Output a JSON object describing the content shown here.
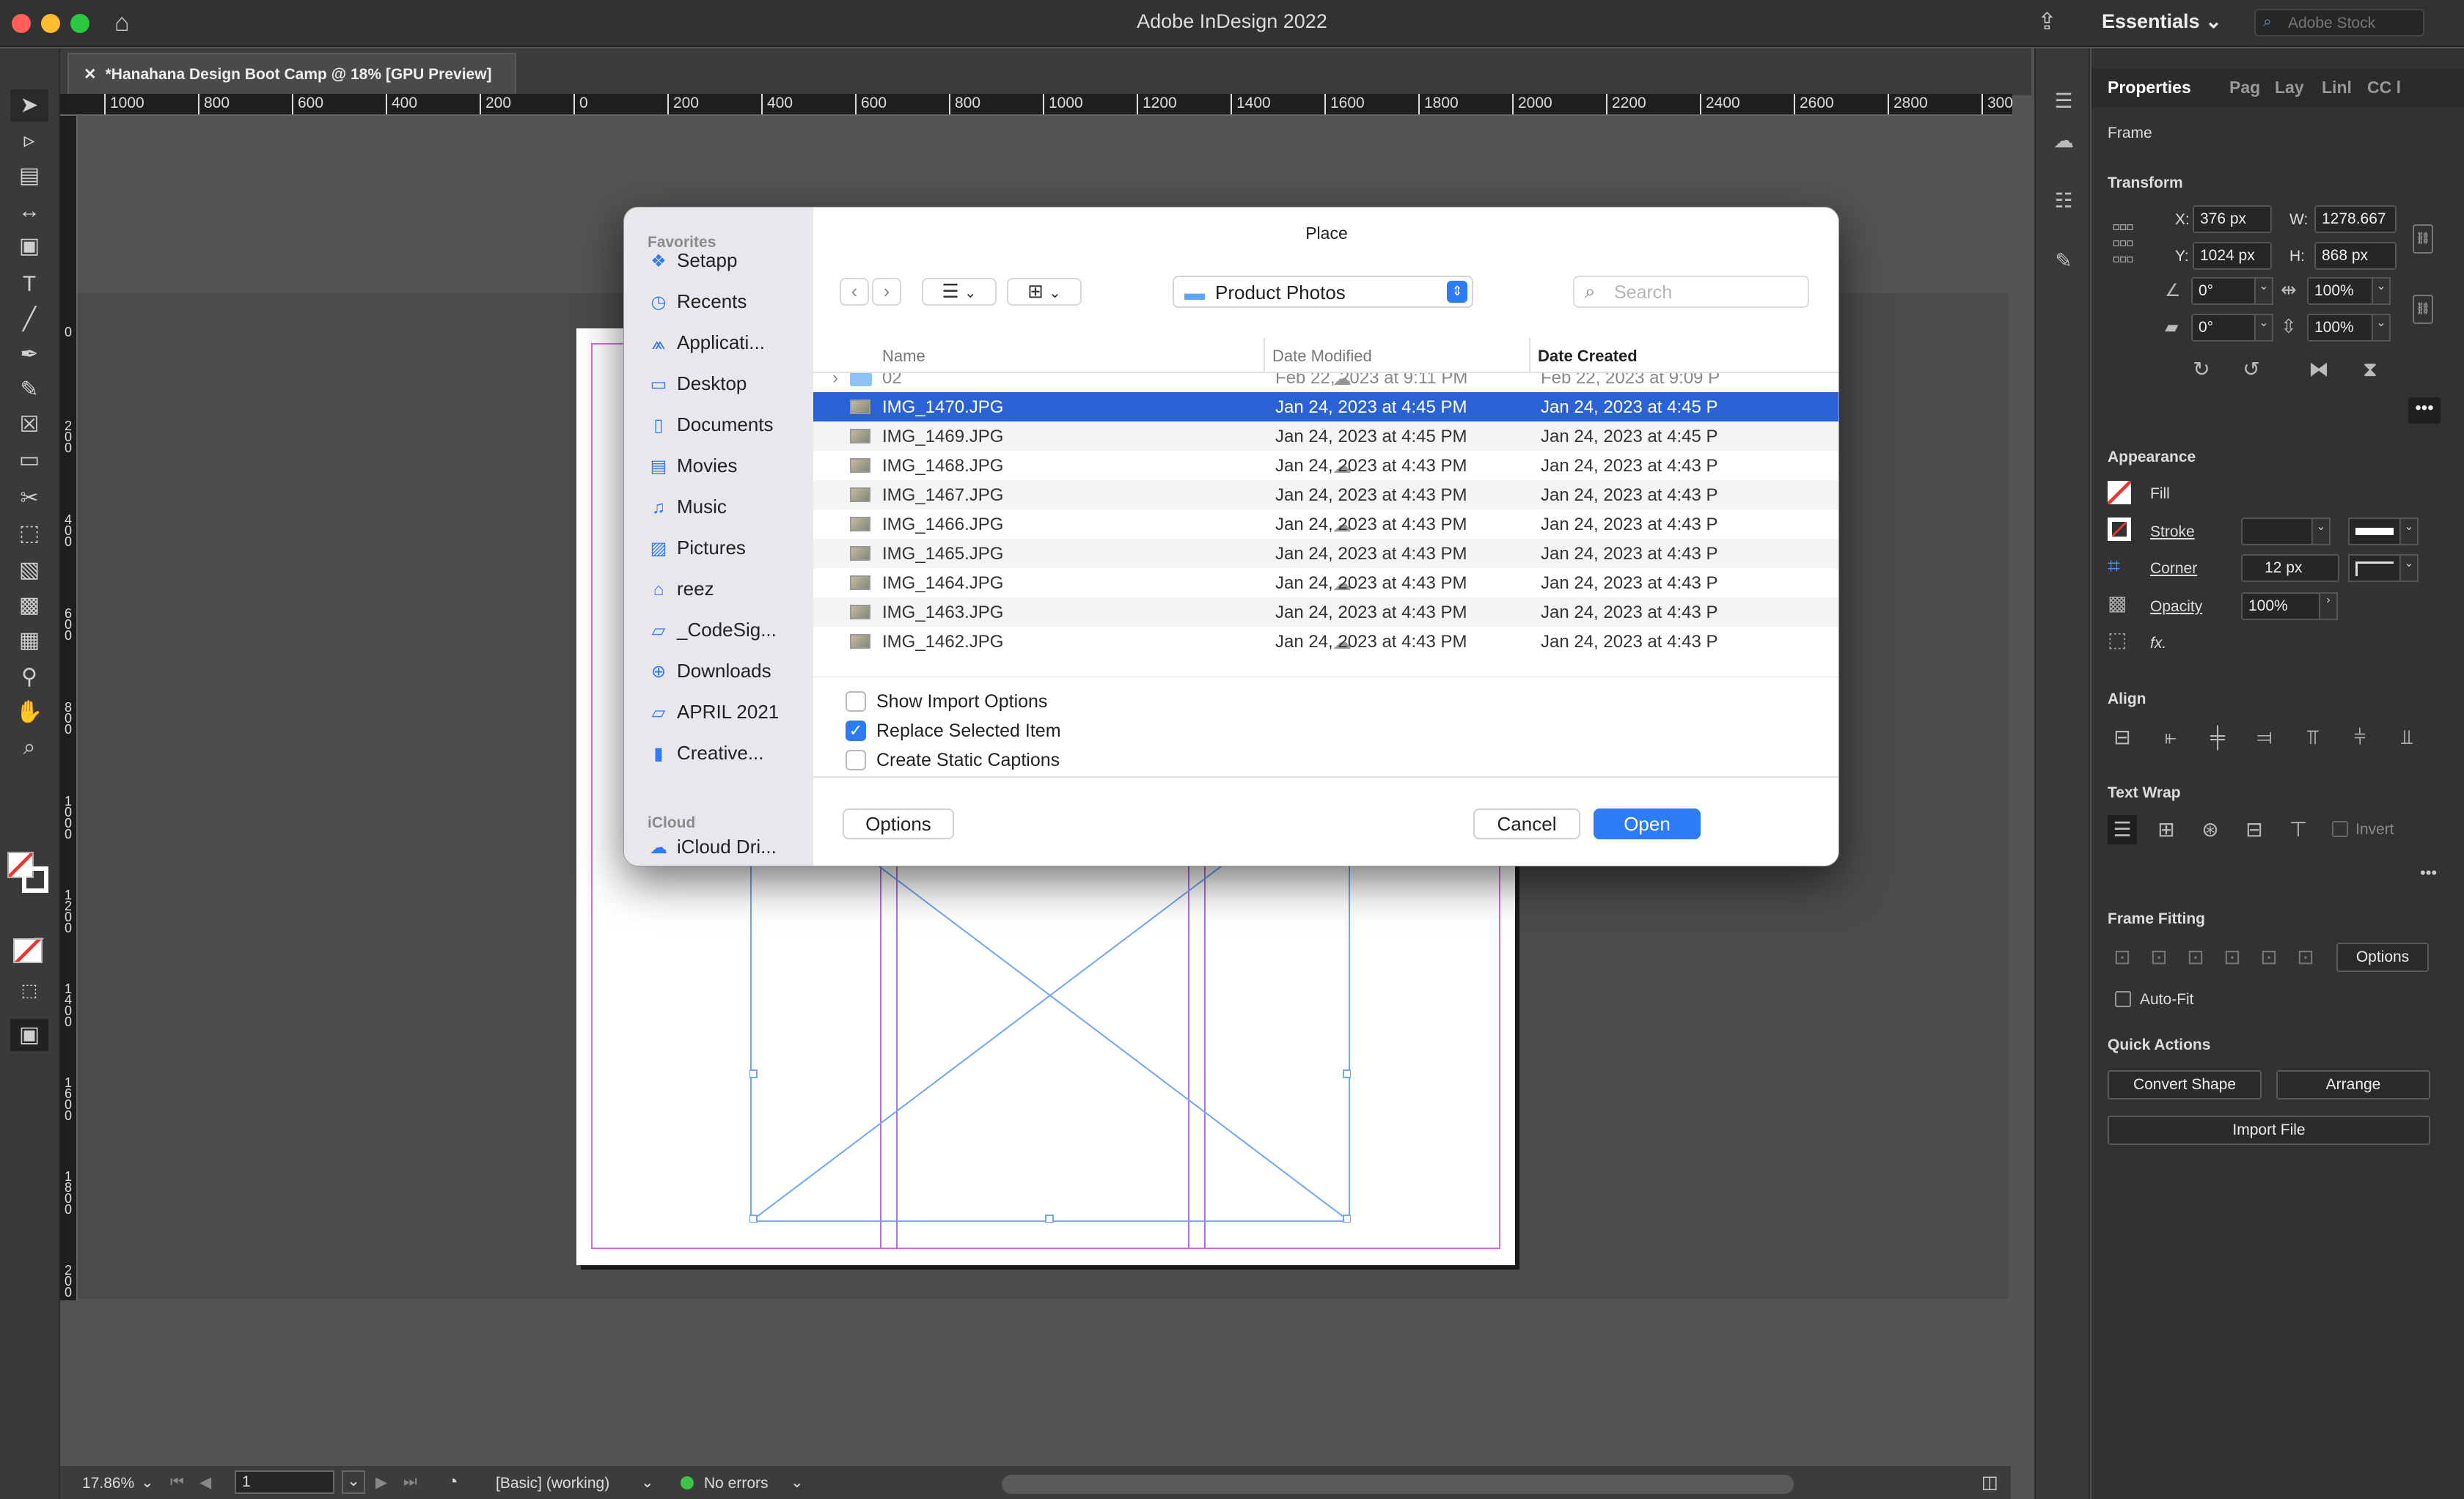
{
  "window": {
    "title": "Adobe InDesign 2022",
    "workspace": "Essentials",
    "stock_placeholder": "Adobe Stock"
  },
  "document": {
    "tab_title": "*Hanahana Design Boot Camp @ 18% [GPU Preview]"
  },
  "ruler": {
    "h_labels": [
      "1000",
      "800",
      "600",
      "400",
      "200",
      "0",
      "200",
      "400",
      "600",
      "800",
      "1000",
      "1200",
      "1400",
      "1600",
      "1800",
      "2000",
      "2200",
      "2400",
      "2600",
      "2800",
      "300"
    ],
    "v_labels": [
      "0",
      "200",
      "400",
      "600",
      "800",
      "1000",
      "1200",
      "1400",
      "1600",
      "1800",
      "200"
    ]
  },
  "status": {
    "zoom": "17.86%",
    "page": "1",
    "style": "[Basic] (working)",
    "errors": "No errors"
  },
  "panel": {
    "tabs": [
      "Properties",
      "Pag",
      "Lay",
      "Linl",
      "CC l"
    ],
    "frame_label": "Frame",
    "transform": {
      "heading": "Transform",
      "x_label": "X:",
      "x": "376 px",
      "y_label": "Y:",
      "y": "1024 px",
      "w_label": "W:",
      "w": "1278.667",
      "h_label": "H:",
      "h": "868 px",
      "angle": "0°",
      "shear": "0°",
      "scale_x": "100%",
      "scale_y": "100%"
    },
    "appearance": {
      "heading": "Appearance",
      "fill": "Fill",
      "stroke": "Stroke",
      "corner": "Corner",
      "corner_value": "12 px",
      "opacity": "Opacity",
      "opacity_value": "100%",
      "fx": "fx."
    },
    "align_heading": "Align",
    "text_wrap": {
      "heading": "Text Wrap",
      "invert": "Invert"
    },
    "frame_fitting": {
      "heading": "Frame Fitting",
      "options": "Options",
      "autofit": "Auto-Fit"
    },
    "quick_actions": {
      "heading": "Quick Actions",
      "convert": "Convert Shape",
      "arrange": "Arrange",
      "import": "Import File"
    }
  },
  "dialog": {
    "title": "Place",
    "location": "Product Photos",
    "search_placeholder": "Search",
    "sidebar": {
      "favorites_heading": "Favorites",
      "favorites": [
        "Setapp",
        "Recents",
        "Applicati...",
        "Desktop",
        "Documents",
        "Movies",
        "Music",
        "Pictures",
        "reez",
        "_CodeSig...",
        "Downloads",
        "APRIL 2021",
        "Creative..."
      ],
      "icloud_heading": "iCloud",
      "icloud": [
        "iCloud Dri..."
      ]
    },
    "columns": {
      "name": "Name",
      "modified": "Date Modified",
      "created": "Date Created"
    },
    "files": [
      {
        "name": "02",
        "modified": "Feb 22, 2023 at 9:11 PM",
        "created": "Feb 22, 2023 at 9:09 P"
      },
      {
        "name": "IMG_1470.JPG",
        "modified": "Jan 24, 2023 at 4:45 PM",
        "created": "Jan 24, 2023 at 4:45 P"
      },
      {
        "name": "IMG_1469.JPG",
        "modified": "Jan 24, 2023 at 4:45 PM",
        "created": "Jan 24, 2023 at 4:45 P"
      },
      {
        "name": "IMG_1468.JPG",
        "modified": "Jan 24, 2023 at 4:43 PM",
        "created": "Jan 24, 2023 at 4:43 P"
      },
      {
        "name": "IMG_1467.JPG",
        "modified": "Jan 24, 2023 at 4:43 PM",
        "created": "Jan 24, 2023 at 4:43 P"
      },
      {
        "name": "IMG_1466.JPG",
        "modified": "Jan 24, 2023 at 4:43 PM",
        "created": "Jan 24, 2023 at 4:43 P"
      },
      {
        "name": "IMG_1465.JPG",
        "modified": "Jan 24, 2023 at 4:43 PM",
        "created": "Jan 24, 2023 at 4:43 P"
      },
      {
        "name": "IMG_1464.JPG",
        "modified": "Jan 24, 2023 at 4:43 PM",
        "created": "Jan 24, 2023 at 4:43 P"
      },
      {
        "name": "IMG_1463.JPG",
        "modified": "Jan 24, 2023 at 4:43 PM",
        "created": "Jan 24, 2023 at 4:43 P"
      },
      {
        "name": "IMG_1462.JPG",
        "modified": "Jan 24, 2023 at 4:43 PM",
        "created": "Jan 24, 2023 at 4:43 P"
      }
    ],
    "options": {
      "show_import": "Show Import Options",
      "replace": "Replace Selected Item",
      "captions": "Create Static Captions"
    },
    "buttons": {
      "options": "Options",
      "cancel": "Cancel",
      "open": "Open"
    }
  }
}
